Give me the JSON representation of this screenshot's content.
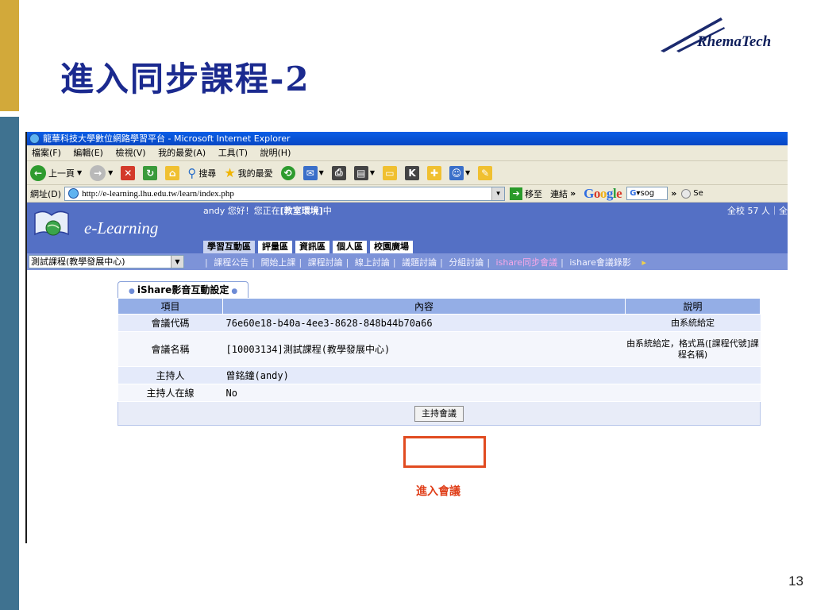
{
  "slide": {
    "title": "進入同步課程-2",
    "logo_text": "RhemaTech",
    "page_number": "13",
    "colors": {
      "gold_bar": "#d2a93a",
      "blue_bar": "#3f7290",
      "title": "#1b2a8f"
    }
  },
  "browser": {
    "window_title": "龍華科技大學數位網路學習平台 - Microsoft Internet Explorer",
    "menu": [
      "檔案(F)",
      "編輯(E)",
      "檢視(V)",
      "我的最愛(A)",
      "工具(T)",
      "說明(H)"
    ],
    "toolbar": {
      "back_label": "上一頁",
      "search_label": "搜尋",
      "favorites_label": "我的最愛"
    },
    "address": {
      "label": "網址(D)",
      "url": "http://e-learning.lhu.edu.tw/learn/index.php",
      "go_label": "移至",
      "links_label": "連結",
      "google_search_value": "sog"
    }
  },
  "elearning": {
    "brand": "e-Learning",
    "greeting_prefix": "andy 您好！您正在",
    "greeting_place": "[教室環境]",
    "greeting_suffix": "中",
    "online_count": "全校 57 人｜全",
    "tabs": [
      "學習互動區",
      "評量區",
      "資訊區",
      "個人區",
      "校園廣場"
    ],
    "course_select": "測試課程(教學發展中心)",
    "sublinks": [
      "課程公告",
      "開始上課",
      "課程討論",
      "線上討論",
      "議題討論",
      "分組討論",
      "ishare同步會議",
      "ishare會議錄影"
    ],
    "active_sublink": "ishare同步會議"
  },
  "panel": {
    "tab_title": "iShare影音互動設定",
    "headers": {
      "item": "項目",
      "content": "內容",
      "desc": "說明"
    },
    "rows": [
      {
        "item": "會議代碼",
        "content": "76e60e18-b40a-4ee3-8628-848b44b70a66",
        "desc": "由系統給定"
      },
      {
        "item": "會議名稱",
        "content": "[10003134]測試課程(教學發展中心)",
        "desc": "由系統給定，格式爲([課程代號]課程名稱)"
      },
      {
        "item": "主持人",
        "content": "曾銘鐘(andy)",
        "desc": ""
      },
      {
        "item": "主持人在線",
        "content": "No",
        "desc": ""
      }
    ],
    "host_button": "主持會議",
    "annotation": "進入會議"
  }
}
